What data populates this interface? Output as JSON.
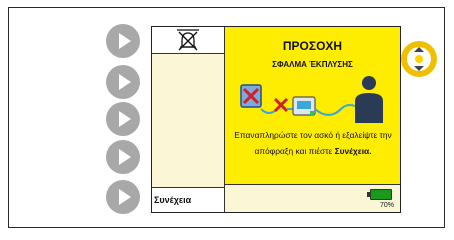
{
  "nav_buttons": [
    "play-right",
    "play-right",
    "play-right",
    "play-right",
    "play-right"
  ],
  "alarm": {
    "icon": "bell-muted-icon"
  },
  "softkey": {
    "label": "Συνέχεια"
  },
  "alert": {
    "title": "ΠΡΟΣΟΧΗ",
    "subtitle": "ΣΦΑΛΜΑ ΈΚΠΛΥΣΗΣ",
    "message_prefix": "Επαναπληρώστε τον ασκό ή εξαλείψτε την απόφραξη και πιέστε",
    "message_action": "Συνέχεια."
  },
  "battery": {
    "percent": "70%",
    "level": 0.7
  },
  "colors": {
    "alert_yellow": "#ffed00",
    "panel_cream": "#fbf7d6",
    "knob_ring": "#f0c000",
    "nav_grey": "#a8a8a8"
  }
}
